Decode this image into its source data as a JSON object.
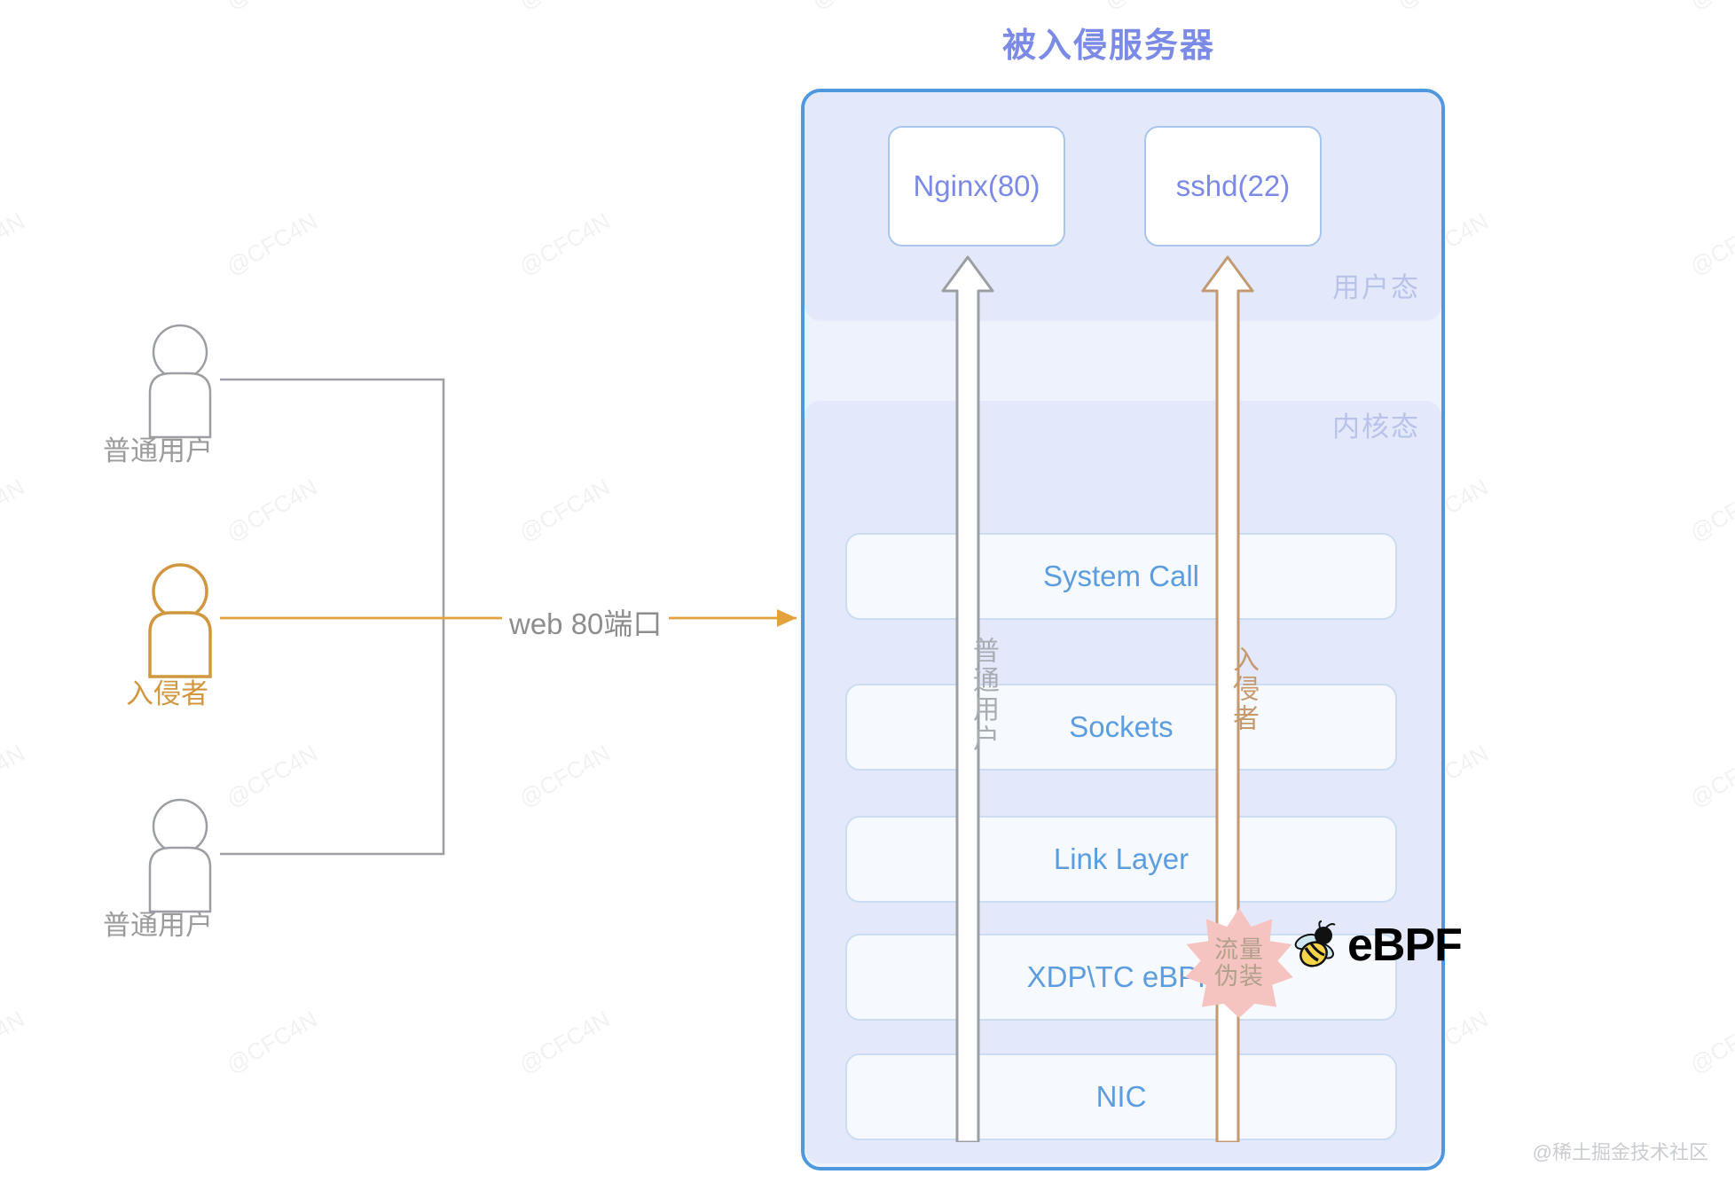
{
  "title": "被入侵服务器",
  "watermark": {
    "tile_text": "@CFC4N",
    "footer_credit": "@稀土掘金技术社区"
  },
  "server": {
    "bands": {
      "user_space": "用户态",
      "kernel_space": "内核态"
    },
    "processes": [
      {
        "name": "nginx",
        "label": "Nginx(80)"
      },
      {
        "name": "sshd",
        "label": "sshd(22)"
      }
    ],
    "kernel_layers": [
      {
        "name": "system-call",
        "label": "System Call"
      },
      {
        "name": "sockets",
        "label": "Sockets"
      },
      {
        "name": "link-layer",
        "label": "Link Layer"
      },
      {
        "name": "xdp-tc-ebpf",
        "label": "XDP\\TC eBPF"
      },
      {
        "name": "nic",
        "label": "NIC"
      }
    ],
    "badge": {
      "line1": "流量",
      "line2": "伪装"
    },
    "logo": {
      "text": "eBPF",
      "icon": "bee-icon"
    }
  },
  "flows": [
    {
      "name": "normal-user-flow",
      "label": "普通用户",
      "color": "#a9adb3"
    },
    {
      "name": "intruder-flow",
      "label": "入侵者",
      "color": "#c79a6e"
    }
  ],
  "actors": [
    {
      "name": "normal-user-top",
      "label": "普通用户",
      "color": "#9b9b9b"
    },
    {
      "name": "intruder",
      "label": "入侵者",
      "color": "#d0973f"
    },
    {
      "name": "normal-user-bottom",
      "label": "普通用户",
      "color": "#9b9b9b"
    }
  ],
  "connection": {
    "label": "web 80端口",
    "color": "#e2a33c"
  },
  "colors": {
    "title": "#7b8ae6",
    "server_border": "#4f97df",
    "band": "#e3e9fb",
    "layer_text": "#5b9de0",
    "intruder": "#d0973f",
    "normal": "#9b9b9b",
    "badge": "#f5c4c0"
  }
}
